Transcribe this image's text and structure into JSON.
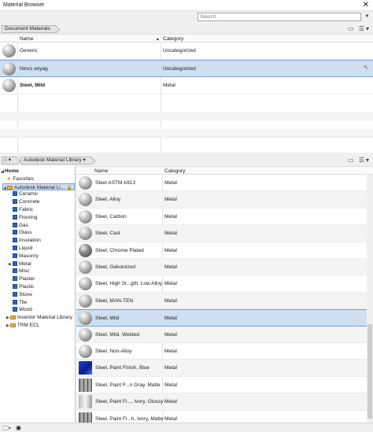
{
  "window": {
    "title": "Material Browser",
    "close_glyph": "✕"
  },
  "search": {
    "placeholder": "Search",
    "dropdown_glyph": "▼"
  },
  "document_materials": {
    "breadcrumb": "Document Materials",
    "columns": {
      "name": "Name",
      "category": "Category"
    },
    "rows": [
      {
        "name": "Generic",
        "category": "Uncategorized",
        "bold": false,
        "selected": false
      },
      {
        "name": "Nincs anyag",
        "category": "Uncategorized",
        "bold": false,
        "selected": true
      },
      {
        "name": "Steel, Mild",
        "category": "Metal",
        "bold": true,
        "selected": false
      }
    ]
  },
  "library": {
    "breadcrumb": "Autodesk Material Library",
    "tree": [
      {
        "label": "Home",
        "level": 0,
        "icon": "expander-icon",
        "bold": true
      },
      {
        "label": "Favorites",
        "level": 1,
        "icon": "star-icon"
      },
      {
        "label": "Autodesk Material Li...",
        "level": 1,
        "icon": "folder-icon",
        "selected": true,
        "locked": true
      },
      {
        "label": "Ceramic",
        "level": 2,
        "icon": "category-icon"
      },
      {
        "label": "Concrete",
        "level": 2,
        "icon": "category-icon"
      },
      {
        "label": "Fabric",
        "level": 2,
        "icon": "category-icon"
      },
      {
        "label": "Flooring",
        "level": 2,
        "icon": "category-icon"
      },
      {
        "label": "Gas",
        "level": 2,
        "icon": "category-icon"
      },
      {
        "label": "Glass",
        "level": 2,
        "icon": "category-icon"
      },
      {
        "label": "Insulation",
        "level": 2,
        "icon": "category-icon"
      },
      {
        "label": "Liquid",
        "level": 2,
        "icon": "category-icon"
      },
      {
        "label": "Masonry",
        "level": 2,
        "icon": "category-icon"
      },
      {
        "label": "Metal",
        "level": 2,
        "icon": "category-icon",
        "expander": true
      },
      {
        "label": "Misc",
        "level": 2,
        "icon": "category-icon"
      },
      {
        "label": "Plaster",
        "level": 2,
        "icon": "category-icon"
      },
      {
        "label": "Plastic",
        "level": 2,
        "icon": "category-icon"
      },
      {
        "label": "Stone",
        "level": 2,
        "icon": "category-icon"
      },
      {
        "label": "Tile",
        "level": 2,
        "icon": "category-icon"
      },
      {
        "label": "Wood",
        "level": 2,
        "icon": "category-icon"
      },
      {
        "label": "Inventor Material Library",
        "level": 1,
        "icon": "folder-icon",
        "expander": true
      },
      {
        "label": "TRM ECL",
        "level": 1,
        "icon": "folder-icon",
        "expander": true
      }
    ],
    "columns": {
      "name": "Name",
      "category": "Category"
    },
    "rows": [
      {
        "name": "Steel ASTM A913",
        "category": "Metal",
        "swatch": "metal"
      },
      {
        "name": "Steel, Alloy",
        "category": "Metal",
        "swatch": "metal"
      },
      {
        "name": "Steel, Carbon",
        "category": "Metal",
        "swatch": "metal"
      },
      {
        "name": "Steel, Cast",
        "category": "Metal",
        "swatch": "metal"
      },
      {
        "name": "Steel, Chrome Plated",
        "category": "Metal",
        "swatch": "dark"
      },
      {
        "name": "Steel, Galvanized",
        "category": "Metal",
        "swatch": "metal"
      },
      {
        "name": "Steel, High St...gth, Low Alloy",
        "category": "Metal",
        "swatch": "metal"
      },
      {
        "name": "Steel, MAN-TEN",
        "category": "Metal",
        "swatch": "metal"
      },
      {
        "name": "Steel, Mild",
        "category": "Metal",
        "swatch": "metal",
        "selected": true
      },
      {
        "name": "Steel, Mild, Welded",
        "category": "Metal",
        "swatch": "metal"
      },
      {
        "name": "Steel, Non-Alloy",
        "category": "Metal",
        "swatch": "metal"
      },
      {
        "name": "Steel, Paint Finish, Blue",
        "category": "Metal",
        "swatch": "blue"
      },
      {
        "name": "Steel, Paint F...n Gray, Matte",
        "category": "Metal",
        "swatch": "rough"
      },
      {
        "name": "Steel, Paint Fi..., Ivory, Glossy",
        "category": "Metal",
        "swatch": "smooth"
      },
      {
        "name": "Steel, Paint Fi...h, Ivory, Matte",
        "category": "Metal",
        "swatch": "rough"
      }
    ]
  },
  "colors": {
    "selection": "#cfdff2",
    "selection_border": "#7da2ce",
    "category_icon": "#2d68b8"
  }
}
